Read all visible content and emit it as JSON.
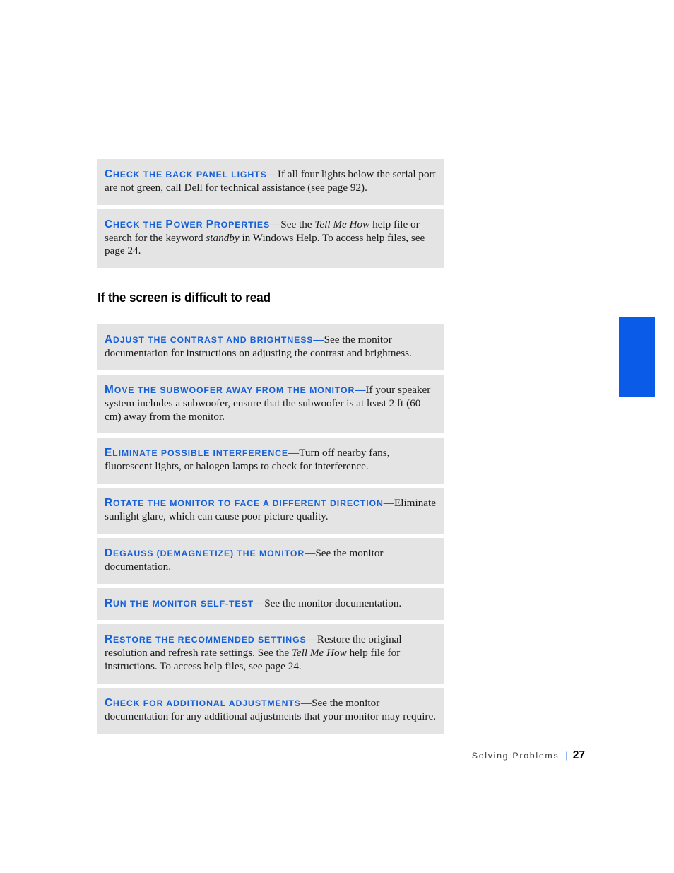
{
  "page": {
    "accent_color": "#1560d8",
    "tab_color": "#0a5be8",
    "box_color": "#e4e4e4"
  },
  "section": {
    "heading": "If the screen is difficult to read"
  },
  "tips_before_heading": [
    {
      "lead": "Check the back panel lights",
      "dash": "—",
      "body_parts": [
        {
          "text": "If all four lights below the serial port are not green, call Dell for technical assistance (see page 92).",
          "italic": false
        }
      ]
    },
    {
      "lead": "Check the Power Properties",
      "dash": "—",
      "body_parts": [
        {
          "text": "See the ",
          "italic": false
        },
        {
          "text": "Tell Me How",
          "italic": true
        },
        {
          "text": " help file or search for the keyword ",
          "italic": false
        },
        {
          "text": "standby",
          "italic": true
        },
        {
          "text": " in Windows Help. To access help files, see page 24.",
          "italic": false
        }
      ]
    }
  ],
  "tips_after_heading": [
    {
      "lead": "Adjust the contrast and brightness",
      "dash": "—",
      "body_parts": [
        {
          "text": "See the monitor documentation for instructions on adjusting the contrast and brightness.",
          "italic": false
        }
      ]
    },
    {
      "lead": "Move the subwoofer away from the monitor",
      "dash": "—",
      "body_parts": [
        {
          "text": "If your speaker system includes a subwoofer, ensure that the subwoofer is at least 2 ft (60 cm) away from the monitor.",
          "italic": false
        }
      ]
    },
    {
      "lead": "Eliminate possible interference",
      "dash": "—",
      "body_parts": [
        {
          "text": "Turn off nearby fans, fluorescent lights, or halogen lamps to check for interference.",
          "italic": false
        }
      ]
    },
    {
      "lead": "Rotate the monitor to face a different direction",
      "dash": "—",
      "body_parts": [
        {
          "text": "Eliminate sunlight glare, which can cause poor picture quality.",
          "italic": false
        }
      ]
    },
    {
      "lead": "Degauss (demagnetize) the monitor",
      "dash": "—",
      "body_parts": [
        {
          "text": "See the monitor documentation.",
          "italic": false
        }
      ]
    },
    {
      "lead": "Run the monitor self-test",
      "dash": "—",
      "body_parts": [
        {
          "text": "See the monitor documentation.",
          "italic": false
        }
      ]
    },
    {
      "lead": "Restore the recommended settings",
      "dash": "—",
      "body_parts": [
        {
          "text": "Restore the original resolution and refresh rate settings. See the ",
          "italic": false
        },
        {
          "text": "Tell Me How",
          "italic": true
        },
        {
          "text": " help file for instructions. To access help files, see page 24.",
          "italic": false
        }
      ]
    },
    {
      "lead": "Check for additional adjustments",
      "dash": "—",
      "body_parts": [
        {
          "text": "See the monitor documentation for any additional adjustments that your monitor may require.",
          "italic": false
        }
      ]
    }
  ],
  "footer": {
    "label": "Solving Problems",
    "separator": "|",
    "page_number": "27"
  }
}
